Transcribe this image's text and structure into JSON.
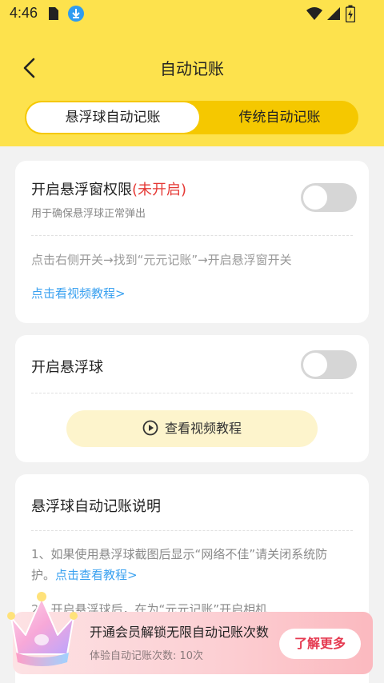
{
  "status_bar": {
    "time": "4:46"
  },
  "header": {
    "title": "自动记账"
  },
  "tabs": [
    {
      "label": "悬浮球自动记账",
      "active": true
    },
    {
      "label": "传统自动记账",
      "active": false
    }
  ],
  "permission_card": {
    "title": "开启悬浮窗权限",
    "status": "(未开启)",
    "subtitle": "用于确保悬浮球正常弹出",
    "instruction": "点击右侧开关→找到“元元记账”→开启悬浮窗开关",
    "link": "点击看视频教程>",
    "toggle_on": false
  },
  "float_ball_card": {
    "title": "开启悬浮球",
    "toggle_on": false,
    "video_button": "查看视频教程"
  },
  "explain_card": {
    "title": "悬浮球自动记账说明",
    "item1": "1、如果使用悬浮球截图后显示“网络不佳”请关闭系统防护。",
    "item1_link": "点击查看教程>",
    "item2_partial": "2、开启悬浮球后，在为“元元记账”开启相机"
  },
  "banner": {
    "title": "开通会员解锁无限自动记账次数",
    "subtitle": "体验自动记账次数: 10次",
    "button": "了解更多"
  },
  "colors": {
    "header_bg": "#fde24d",
    "segment_bg": "#f5c800",
    "status_red": "#e53935",
    "link_blue": "#3aa1f0",
    "video_btn_bg": "#fdf4cc",
    "banner_button_text": "#e53950"
  }
}
